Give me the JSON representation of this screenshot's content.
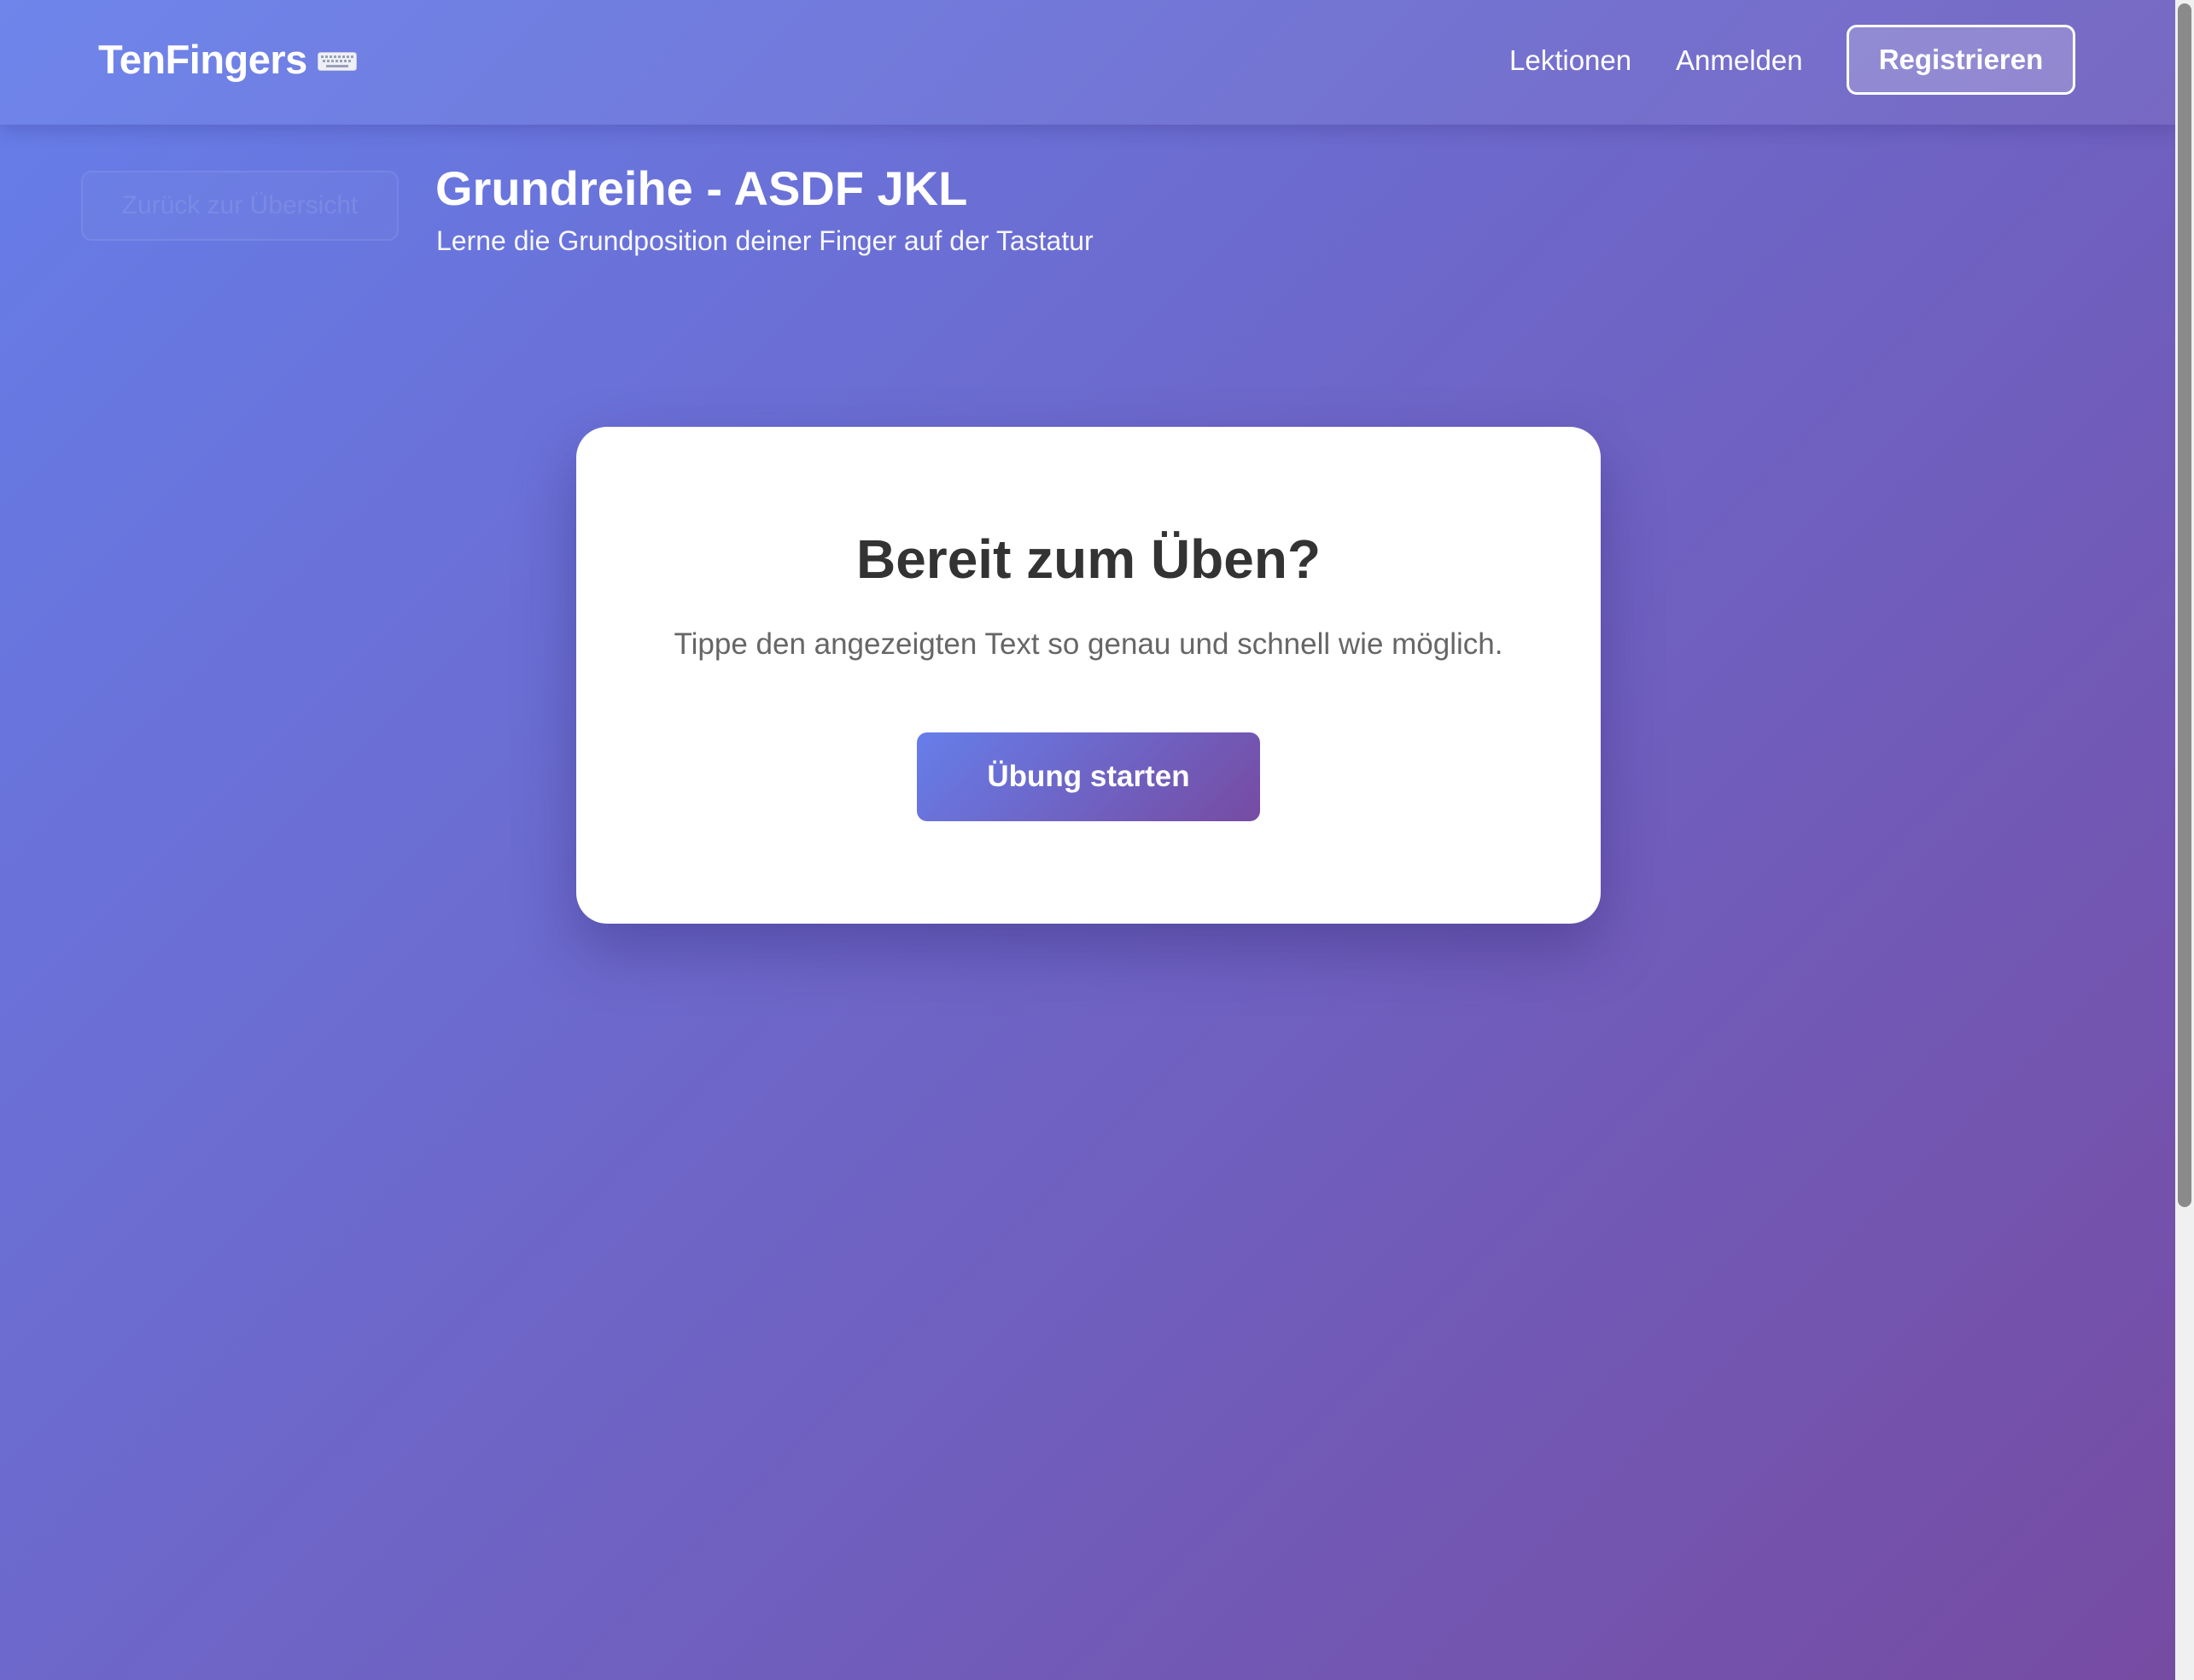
{
  "header": {
    "logo_text": "TenFingers",
    "logo_icon": "keyboard-icon",
    "nav": {
      "lessons_label": "Lektionen",
      "login_label": "Anmelden",
      "register_label": "Registrieren"
    }
  },
  "lesson": {
    "back_label": "Zurück zur Übersicht",
    "title": "Grundreihe - ASDF JKL",
    "subtitle": "Lerne die Grundposition deiner Finger auf der Tastatur"
  },
  "card": {
    "title": "Bereit zum Üben?",
    "text": "Tippe den angezeigten Text so genau und schnell wie möglich.",
    "start_label": "Übung starten"
  },
  "colors": {
    "gradient_start": "#667eea",
    "gradient_end": "#764ba2",
    "card_background": "#ffffff",
    "card_title": "#333333",
    "card_text": "#666666"
  }
}
